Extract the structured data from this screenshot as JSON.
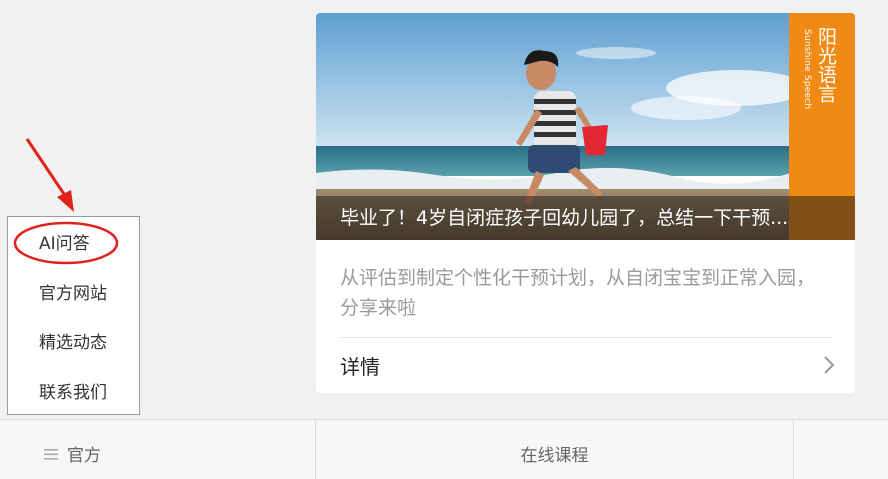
{
  "article": {
    "brand_cn": "阳光语言",
    "brand_en": "Sunshine Speech",
    "title": "毕业了！4岁自闭症孩子回幼儿园了，总结一下干预...",
    "summary": "从评估到制定个性化干预计划，从自闭宝宝到正常入园，分享来啦",
    "details_label": "详情"
  },
  "popup_menu": {
    "items": [
      {
        "label": "AI问答",
        "highlighted": true
      },
      {
        "label": "官方网站"
      },
      {
        "label": "精选动态"
      },
      {
        "label": "联系我们"
      }
    ]
  },
  "bottom_bar": {
    "items": [
      {
        "label": "官方",
        "icon": "menu-icon"
      },
      {
        "label": "在线课程"
      }
    ]
  },
  "colors": {
    "brand_orange": "#f08a14",
    "annotation_red": "#e0211c",
    "background": "#f1f1f1"
  }
}
